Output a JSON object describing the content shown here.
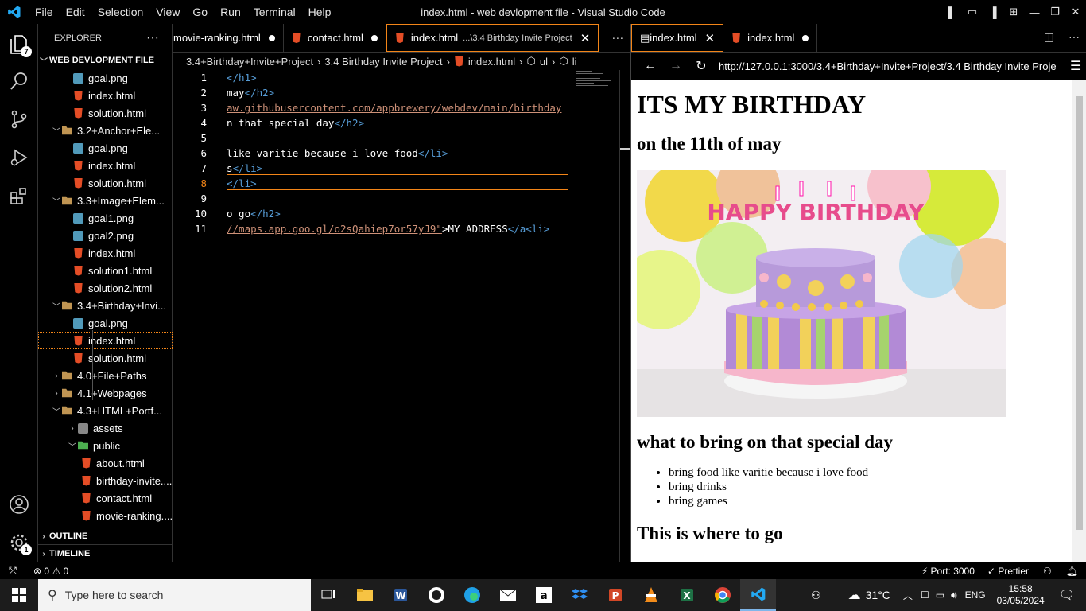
{
  "titlebar": {
    "menus": [
      "File",
      "Edit",
      "Selection",
      "View",
      "Go",
      "Run",
      "Terminal",
      "Help"
    ],
    "window_title": "index.html - web devlopment file - Visual Studio Code",
    "layout_icons": [
      "layout-sidebar-left-icon",
      "layout-panel-icon",
      "layout-sidebar-right-icon",
      "customize-layout-icon"
    ]
  },
  "activity_bar": {
    "explorer_badge": "7",
    "settings_badge": "1"
  },
  "explorer": {
    "header": "EXPLORER",
    "root": "WEB DEVLOPMENT FILE",
    "items": [
      {
        "depth": 2,
        "type": "png",
        "label": "goal.png"
      },
      {
        "depth": 2,
        "type": "html",
        "label": "index.html"
      },
      {
        "depth": 2,
        "type": "html",
        "label": "solution.html"
      },
      {
        "depth": 1,
        "type": "folder",
        "open": true,
        "label": "3.2+Anchor+Ele..."
      },
      {
        "depth": 2,
        "type": "png",
        "label": "goal.png"
      },
      {
        "depth": 2,
        "type": "html",
        "label": "index.html"
      },
      {
        "depth": 2,
        "type": "html",
        "label": "solution.html"
      },
      {
        "depth": 1,
        "type": "folder",
        "open": true,
        "label": "3.3+Image+Elem..."
      },
      {
        "depth": 2,
        "type": "png",
        "label": "goal1.png"
      },
      {
        "depth": 2,
        "type": "png",
        "label": "goal2.png"
      },
      {
        "depth": 2,
        "type": "html",
        "label": "index.html"
      },
      {
        "depth": 2,
        "type": "html",
        "label": "solution1.html"
      },
      {
        "depth": 2,
        "type": "html",
        "label": "solution2.html"
      },
      {
        "depth": 1,
        "type": "folder",
        "open": true,
        "label": "3.4+Birthday+Invi..."
      },
      {
        "depth": 2,
        "type": "png",
        "label": "goal.png"
      },
      {
        "depth": 2,
        "type": "html",
        "label": "index.html",
        "selected": true
      },
      {
        "depth": 2,
        "type": "html",
        "label": "solution.html"
      },
      {
        "depth": 1,
        "type": "folder",
        "open": false,
        "label": "4.0+File+Paths"
      },
      {
        "depth": 1,
        "type": "folder",
        "open": false,
        "label": "4.1+Webpages"
      },
      {
        "depth": 1,
        "type": "folder",
        "open": true,
        "label": "4.3+HTML+Portf..."
      },
      {
        "depth": 2,
        "type": "assets",
        "open": false,
        "label": "assets"
      },
      {
        "depth": 2,
        "type": "public",
        "open": true,
        "label": "public"
      },
      {
        "depth": 3,
        "type": "html",
        "label": "about.html"
      },
      {
        "depth": 3,
        "type": "html",
        "label": "birthday-invite...."
      },
      {
        "depth": 3,
        "type": "html",
        "label": "contact.html"
      },
      {
        "depth": 3,
        "type": "html",
        "label": "movie-ranking...."
      }
    ],
    "outline": "OUTLINE",
    "timeline": "TIMELINE"
  },
  "editor": {
    "tabs": [
      {
        "label": "movie-ranking.html",
        "modified": true,
        "active": false
      },
      {
        "label": "contact.html",
        "modified": true,
        "active": false
      },
      {
        "label": "index.html",
        "desc": "...\\3.4 Birthday Invite Project",
        "active": true
      }
    ],
    "breadcrumb": [
      "3.4+Birthday+Invite+Project",
      "3.4 Birthday Invite Project",
      "index.html",
      "ul",
      "li"
    ],
    "lines": [
      {
        "n": "1",
        "parts": [
          {
            "c": "tg",
            "t": "</h1>"
          }
        ]
      },
      {
        "n": "2",
        "parts": [
          {
            "c": "txt",
            "t": "may"
          },
          {
            "c": "tg",
            "t": "</h2>"
          }
        ]
      },
      {
        "n": "3",
        "parts": [
          {
            "c": "url",
            "t": "aw.githubusercontent.com/appbrewery/webdev/main/birthday"
          }
        ]
      },
      {
        "n": "4",
        "parts": [
          {
            "c": "txt",
            "t": "n that special day"
          },
          {
            "c": "tg",
            "t": "</h2>"
          }
        ]
      },
      {
        "n": "5",
        "parts": []
      },
      {
        "n": "6",
        "parts": [
          {
            "c": "txt",
            "t": "like varitie because i love food"
          },
          {
            "c": "tg",
            "t": "</li>"
          }
        ]
      },
      {
        "n": "7",
        "parts": [
          {
            "c": "txt",
            "t": "s"
          },
          {
            "c": "tg",
            "t": "</li>"
          }
        ]
      },
      {
        "n": "8",
        "parts": [
          {
            "c": "tg",
            "t": "</li>"
          }
        ]
      },
      {
        "n": "9",
        "parts": []
      },
      {
        "n": "10",
        "parts": [
          {
            "c": "txt",
            "t": "o go"
          },
          {
            "c": "tg",
            "t": "</h2>"
          }
        ]
      },
      {
        "n": "11",
        "parts": [
          {
            "c": "url",
            "t": "//maps.app.goo.gl/o2sQahiep7or57yJ9\""
          },
          {
            "c": "txt",
            "t": ">MY ADDRESS"
          },
          {
            "c": "tg",
            "t": "</a<li>"
          }
        ]
      }
    ]
  },
  "preview": {
    "tabs": [
      {
        "label": "index.html",
        "type": "preview",
        "active": true
      },
      {
        "label": "index.html",
        "type": "html",
        "modified": true
      }
    ],
    "url": "http://127.0.0.1:3000/3.4+Birthday+Invite+Project/3.4 Birthday Invite Proje",
    "page": {
      "h1": "ITS MY BIRTHDAY",
      "h2_date": "on the 11th of may",
      "cake_text": "HAPPY BIRTHDAY",
      "h2_bring": "what to bring on that special day",
      "list": [
        "bring food like varitie because i love food",
        "bring drinks",
        "bring games"
      ],
      "h2_where": "This is where to go"
    }
  },
  "statusbar": {
    "problems": "0",
    "warnings": "0",
    "port": "Port: 3000",
    "prettier": "Prettier"
  },
  "taskbar": {
    "search_placeholder": "Type here to search",
    "temperature": "31°C",
    "language": "ENG",
    "time": "15:58",
    "date": "03/05/2024"
  },
  "colors": {
    "accent": "#f38518",
    "html_icon": "#e44d26",
    "tag": "#569cd6",
    "string": "#ce9178"
  }
}
